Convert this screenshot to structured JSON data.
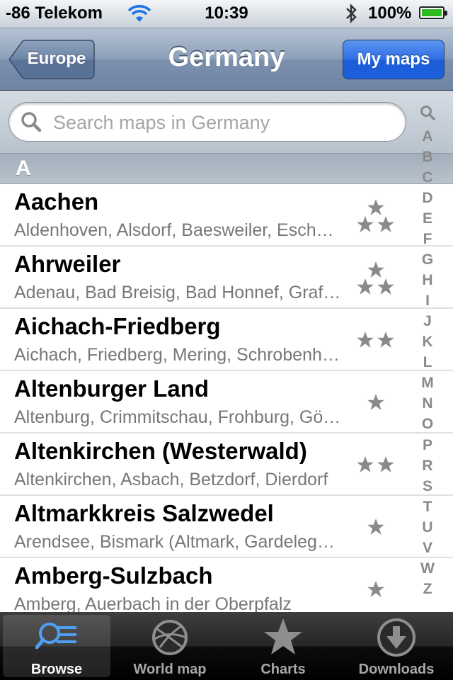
{
  "status_bar": {
    "carrier": "-86 Telekom",
    "time": "10:39",
    "battery_percent": "100%"
  },
  "nav": {
    "back_label": "Europe",
    "title": "Germany",
    "right_button": "My maps"
  },
  "search": {
    "placeholder": "Search maps in Germany"
  },
  "section": {
    "header": "A"
  },
  "rows": [
    {
      "name": "Aachen",
      "sub": "Aldenhoven, Alsdorf, Baesweiler, Eschweiler, Herzogenrath",
      "stars": 3
    },
    {
      "name": "Ahrweiler",
      "sub": "Adenau, Bad Breisig, Bad Honnef, Grafschaft",
      "stars": 3
    },
    {
      "name": "Aichach-Friedberg",
      "sub": "Aichach, Friedberg, Mering, Schrobenhausen",
      "stars": 2
    },
    {
      "name": "Altenburger Land",
      "sub": "Altenburg, Crimmitschau, Frohburg, Gößnitz",
      "stars": 1
    },
    {
      "name": "Altenkirchen (Westerwald)",
      "sub": "Altenkirchen, Asbach, Betzdorf, Dierdorf",
      "stars": 2
    },
    {
      "name": "Altmarkkreis Salzwedel",
      "sub": "Arendsee, Bismark (Altmark, Gardelegen)",
      "stars": 1
    },
    {
      "name": "Amberg-Sulzbach",
      "sub": "Amberg, Auerbach in der Oberpfalz",
      "stars": 1
    }
  ],
  "index": [
    "search-glyph",
    "A",
    "B",
    "C",
    "D",
    "E",
    "F",
    "G",
    "H",
    "I",
    "J",
    "K",
    "L",
    "M",
    "N",
    "O",
    "P",
    "R",
    "S",
    "T",
    "U",
    "V",
    "W",
    "Z"
  ],
  "tabs": [
    {
      "label": "Browse",
      "icon": "browse-icon",
      "active": true
    },
    {
      "label": "World map",
      "icon": "globe-icon",
      "active": false
    },
    {
      "label": "Charts",
      "icon": "star-icon",
      "active": false
    },
    {
      "label": "Downloads",
      "icon": "download-icon",
      "active": false
    }
  ],
  "colors": {
    "nav_blue_button": "#2f6fe6",
    "tab_active_icon": "#4ea0f5",
    "star_gray": "#8a8a8a"
  }
}
